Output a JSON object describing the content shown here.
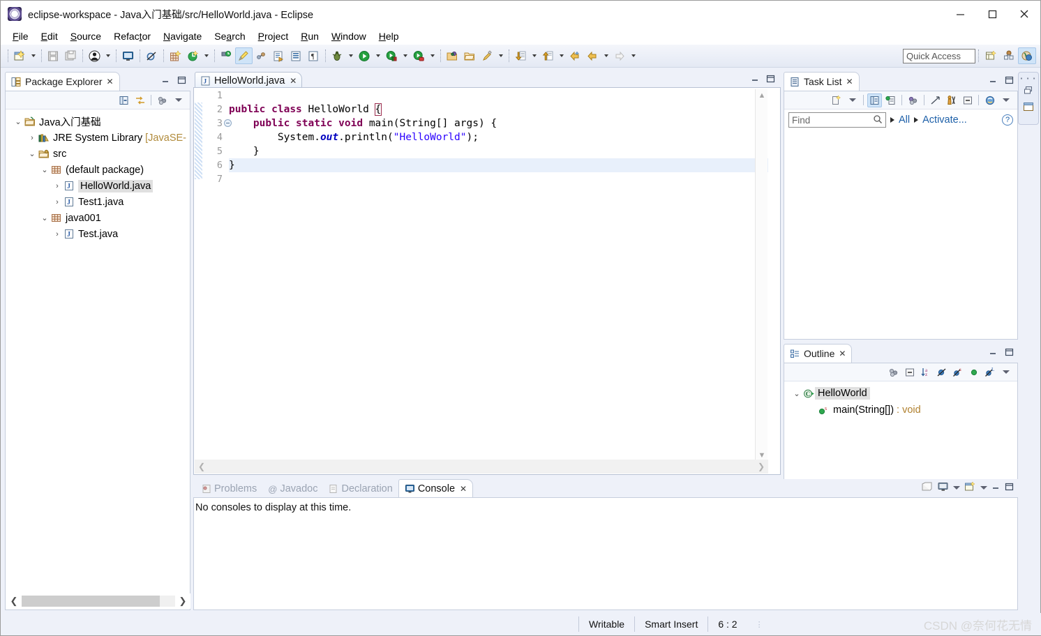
{
  "window": {
    "title": "eclipse-workspace - Java入门基础/src/HelloWorld.java - Eclipse",
    "minimize": "Minimize",
    "maximize": "Maximize",
    "close": "Close"
  },
  "menubar": [
    {
      "label": "File",
      "mnemonic": "F"
    },
    {
      "label": "Edit",
      "mnemonic": "E"
    },
    {
      "label": "Source",
      "mnemonic": "S"
    },
    {
      "label": "Refactor",
      "mnemonic": "t"
    },
    {
      "label": "Navigate",
      "mnemonic": "N"
    },
    {
      "label": "Search",
      "mnemonic": "a"
    },
    {
      "label": "Project",
      "mnemonic": "P"
    },
    {
      "label": "Run",
      "mnemonic": "R"
    },
    {
      "label": "Window",
      "mnemonic": "W"
    },
    {
      "label": "Help",
      "mnemonic": "H"
    }
  ],
  "toolbar": {
    "quick_access_placeholder": "Quick Access",
    "buttons": [
      "new-wizard-icon",
      "save-icon",
      "save-all-icon",
      "user-icon",
      "console-icon",
      "skip-breakpoints-icon",
      "new-package-icon",
      "refresh-icon",
      "toggle-mark-occurrences-icon",
      "pencil-highlight-icon",
      "link-icon",
      "open-task-icon",
      "open-type-icon",
      "show-whitespace-icon",
      "debug-icon",
      "run-icon",
      "coverage-icon",
      "external-tools-icon",
      "open-folder-icon",
      "open-package-icon",
      "search-icon",
      "next-annotation-icon",
      "previous-annotation-icon",
      "back-icon",
      "forward-back-icon",
      "forward-icon"
    ],
    "perspective_buttons": [
      "open-perspective-icon",
      "java-browsing-perspective-icon",
      "java-perspective-icon"
    ]
  },
  "package_explorer": {
    "title": "Package Explorer",
    "toolbar": [
      "collapse-all-icon",
      "link-with-editor-icon",
      "view-menu-icon",
      "view-dropdown-icon"
    ],
    "tree": [
      {
        "label": "Java入门基础",
        "icon": "project-icon",
        "depth": 0,
        "twist": "open",
        "selected": false
      },
      {
        "label": "JRE System Library [JavaSE-",
        "icon": "library-icon",
        "depth": 1,
        "twist": "closed",
        "selected": false,
        "dim_from": 18
      },
      {
        "label": "src",
        "icon": "source-folder-icon",
        "depth": 1,
        "twist": "open",
        "selected": false
      },
      {
        "label": "(default package)",
        "icon": "package-icon",
        "depth": 2,
        "twist": "open",
        "selected": false
      },
      {
        "label": "HelloWorld.java",
        "icon": "java-file-icon",
        "depth": 3,
        "twist": "closed",
        "selected": true
      },
      {
        "label": "Test1.java",
        "icon": "java-file-icon",
        "depth": 3,
        "twist": "closed",
        "selected": false
      },
      {
        "label": "java001",
        "icon": "package-icon",
        "depth": 2,
        "twist": "open",
        "selected": false
      },
      {
        "label": "Test.java",
        "icon": "java-file-icon",
        "depth": 3,
        "twist": "closed",
        "selected": false
      }
    ]
  },
  "editor": {
    "tab_label": "HelloWorld.java",
    "tab_close": "✕",
    "line_numbers": [
      "1",
      "2",
      "3",
      "4",
      "5",
      "6",
      "7"
    ],
    "current_line": 6,
    "fold_line": 3,
    "code_lines": [
      {
        "n": 1,
        "text": ""
      },
      {
        "n": 2,
        "text": "public class HelloWorld {"
      },
      {
        "n": 3,
        "text": "    public static void main(String[] args) {"
      },
      {
        "n": 4,
        "text": "        System.out.println(\"HelloWorld\");"
      },
      {
        "n": 5,
        "text": "    }"
      },
      {
        "n": 6,
        "text": "}"
      },
      {
        "n": 7,
        "text": ""
      }
    ]
  },
  "task_list": {
    "title": "Task List",
    "find_placeholder": "Find",
    "all_label": "All",
    "activate_label": "Activate...",
    "help_label": "?",
    "toolbar": [
      "new-task-icon",
      "new-task-dropdown-icon",
      "categorized-icon",
      "scheduled-icon",
      "presentation-icon",
      "focus-icon",
      "filter-icon",
      "collapse-all-icon",
      "synchronize-icon",
      "view-menu-icon"
    ]
  },
  "outline": {
    "title": "Outline",
    "toolbar": [
      "focus-icon",
      "collapse-all-icon",
      "sort-icon",
      "hide-fields-icon",
      "hide-static-icon",
      "hide-nonpublic-icon",
      "hide-local-icon",
      "view-menu-icon"
    ],
    "items": [
      {
        "label": "HelloWorld",
        "icon": "class-icon",
        "depth": 0,
        "twist": "open",
        "selected": true,
        "type": ""
      },
      {
        "label": "main(String[])",
        "icon": "public-static-method-icon",
        "depth": 1,
        "twist": "none",
        "selected": false,
        "type": " : void"
      }
    ]
  },
  "console": {
    "tabs": [
      {
        "label": "Problems",
        "icon": "problems-icon",
        "active": false
      },
      {
        "label": "Javadoc",
        "icon": "javadoc-icon",
        "active": false
      },
      {
        "label": "Declaration",
        "icon": "declaration-icon",
        "active": false
      },
      {
        "label": "Console",
        "icon": "console-icon",
        "active": true
      }
    ],
    "message": "No consoles to display at this time.",
    "toolbar": [
      "open-console-icon",
      "display-selected-console-icon",
      "display-dropdown-icon",
      "new-console-view-icon",
      "new-console-dropdown-icon"
    ]
  },
  "status_bar": {
    "writable": "Writable",
    "insert_mode": "Smart Insert",
    "position": "6 : 2",
    "watermark": "CSDN @奈何花无情"
  },
  "colors": {
    "keyword": "#7f0055",
    "string": "#2a00ff",
    "field": "#0000c0",
    "link": "#1c5fa8",
    "selection": "#e0e0e0",
    "current_line": "#e8f0fb",
    "panel_bg": "#eef1f9",
    "type_hint": "#b0802e"
  }
}
